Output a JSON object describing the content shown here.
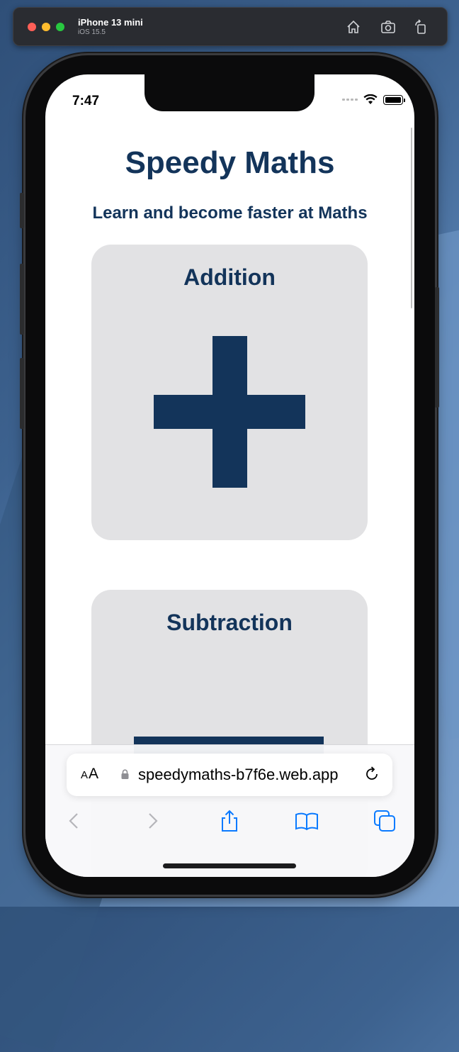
{
  "simulator": {
    "device_name": "iPhone 13 mini",
    "os_version": "iOS 15.5"
  },
  "status_bar": {
    "time": "7:47"
  },
  "page": {
    "title": "Speedy Maths",
    "subtitle": "Learn and become faster at Maths",
    "cards": [
      {
        "label": "Addition",
        "icon": "plus-icon"
      },
      {
        "label": "Subtraction",
        "icon": "minus-icon"
      }
    ]
  },
  "safari": {
    "text_size_label": "AA",
    "url": "speedymaths-b7f6e.web.app",
    "accent_color": "#0a7aff"
  },
  "colors": {
    "brand": "#13345a",
    "card_bg": "#e2e2e4"
  }
}
